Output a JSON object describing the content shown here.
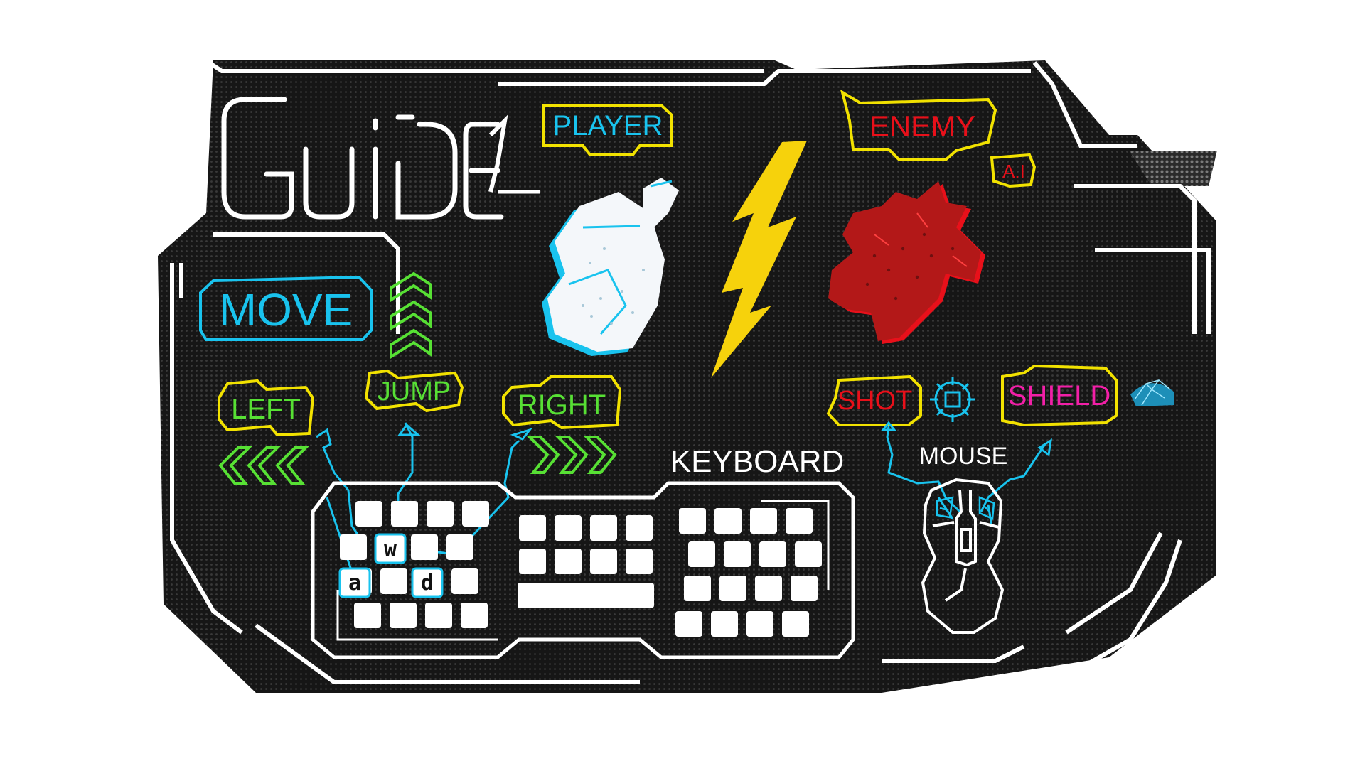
{
  "title": "GUIDE",
  "labels": {
    "player": "PLAYER",
    "enemy": "ENEMY",
    "ai": "A.I",
    "move": "MOVE",
    "left": "LEFT",
    "jump": "JUMP",
    "right": "RIGHT",
    "shot": "SHOT",
    "shield": "SHIELD",
    "keyboard": "KEYBOARD",
    "mouse": "MOUSE"
  },
  "keys": {
    "w": "w",
    "a": "a",
    "d": "d"
  },
  "icons": [
    "player-robot-icon",
    "enemy-creature-icon",
    "lightning-bolt-icon",
    "crosshair-icon",
    "shield-orb-icon",
    "jump-chevrons-icon",
    "left-chevrons-icon",
    "right-chevrons-icon",
    "keyboard-icon",
    "mouse-icon"
  ],
  "colors": {
    "panel": "#141414",
    "outline": "#ffffff",
    "frame_yellow": "#f2e200",
    "cyan": "#19c3ee",
    "green": "#57e034",
    "red": "#e8101a",
    "magenta": "#f21fa8",
    "bolt": "#f6d20c",
    "enemy_fill": "#c21a1a"
  }
}
